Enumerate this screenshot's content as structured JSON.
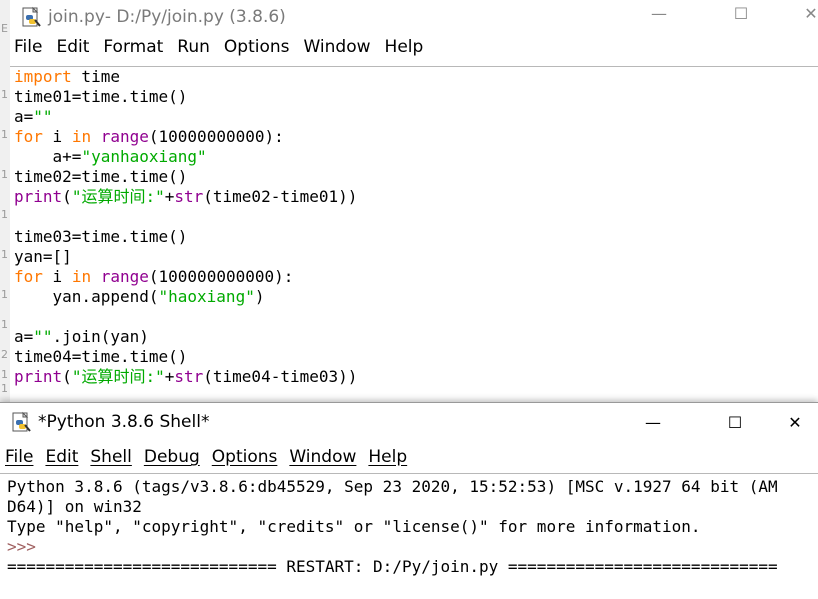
{
  "editor": {
    "title_file": "join.py",
    "title_rest": " - D:/Py/join.py (3.8.6)",
    "menu": [
      "File",
      "Edit",
      "Format",
      "Run",
      "Options",
      "Window",
      "Help"
    ],
    "code": {
      "l1": {
        "kw": "import",
        "rest": " time"
      },
      "l2": {
        "text": "time01=time.time()"
      },
      "l3": {
        "a": "a=",
        "s": "\"\""
      },
      "l4": {
        "for": "for",
        "mid": " i ",
        "in": "in",
        "sp": " ",
        "range": "range",
        "rest": "(10000000000):"
      },
      "l5": {
        "a": "    a+=",
        "s": "\"yanhaoxiang\""
      },
      "l6": {
        "text": "time02=time.time()"
      },
      "l7": {
        "print": "print",
        "p1": "(",
        "s": "\"运算时间:\"",
        "plus": "+",
        "str": "str",
        "rest": "(time02-time01))"
      },
      "l9": {
        "text": "time03=time.time()"
      },
      "l10": {
        "text": "yan=[]"
      },
      "l11": {
        "for": "for",
        "mid": " i ",
        "in": "in",
        "sp": " ",
        "range": "range",
        "rest": "(100000000000):"
      },
      "l12": {
        "a": "    yan.append(",
        "s": "\"haoxiang\"",
        "b": ")"
      },
      "l14": {
        "a": "a=",
        "s": "\"\"",
        "b": ".join(yan)"
      },
      "l15": {
        "text": "time04=time.time()"
      },
      "l16": {
        "print": "print",
        "p1": "(",
        "s": "\"运算时间:\"",
        "plus": "+",
        "str": "str",
        "rest": "(time04-time03))"
      }
    }
  },
  "shell": {
    "title": "*Python 3.8.6 Shell*",
    "menu": [
      "File",
      "Edit",
      "Shell",
      "Debug",
      "Options",
      "Window",
      "Help"
    ],
    "lines": {
      "l1": "Python 3.8.6 (tags/v3.8.6:db45529, Sep 23 2020, 15:52:53) [MSC v.1927 64 bit (AM",
      "l2": "D64)] on win32",
      "l3": "Type \"help\", \"copyright\", \"credits\" or \"license()\" for more information.",
      "prompt": ">>>",
      "l5": "============================ RESTART: D:/Py/join.py ============================"
    }
  },
  "window_controls": {
    "minimize": "—",
    "maximize": "☐",
    "close": "✕"
  },
  "gutter_digits": [
    "E",
    "1",
    "1",
    "1",
    "1",
    "1",
    "1",
    "1",
    "2",
    "1",
    "1",
    "2"
  ]
}
